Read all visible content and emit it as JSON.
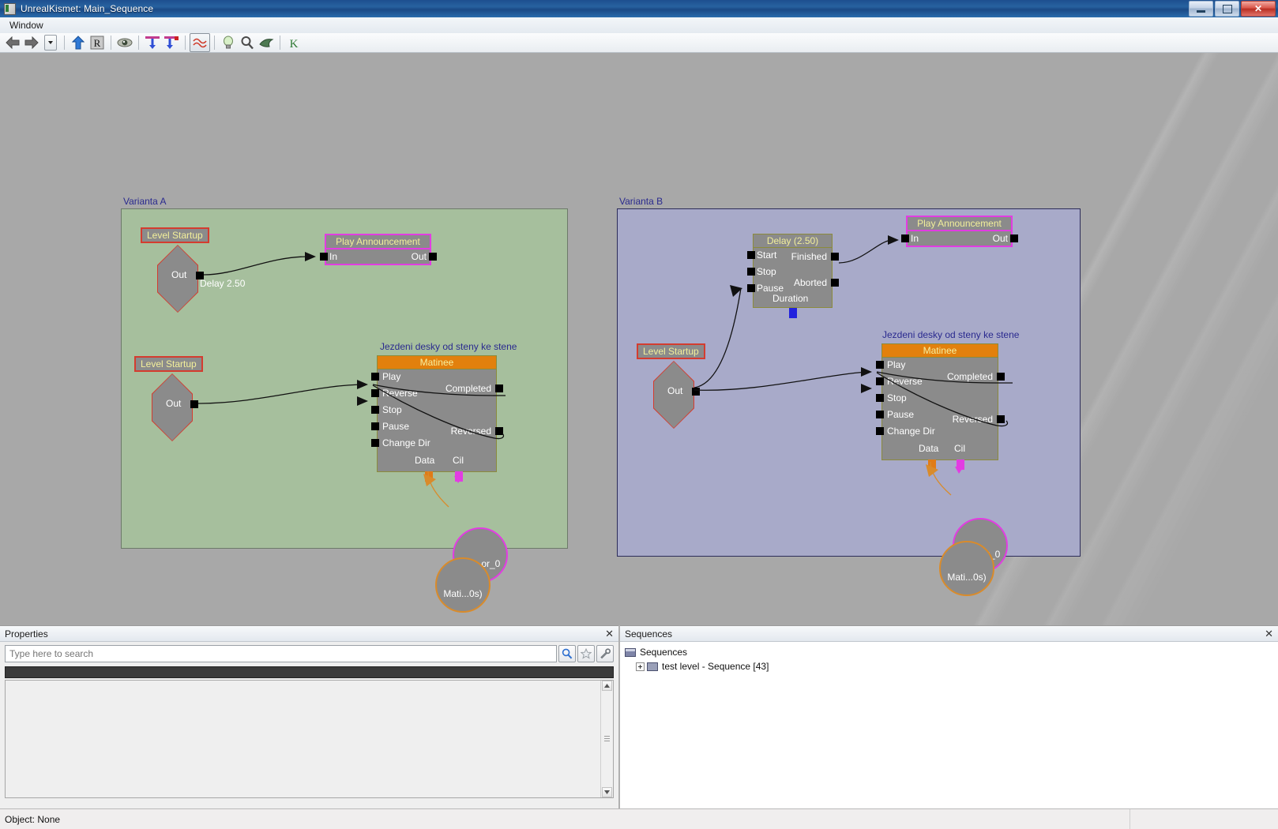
{
  "window": {
    "title": "UnrealKismet: Main_Sequence",
    "icon": "kismet-app-icon",
    "buttons": {
      "minimize": "minimize-icon",
      "maximize": "maximize-icon",
      "close": "✕"
    }
  },
  "menubar": {
    "items": [
      {
        "label": "Window"
      }
    ]
  },
  "toolbar": {
    "items": [
      {
        "name": "back-button",
        "icon": "left-arrow-icon",
        "glyph": "⬅"
      },
      {
        "name": "forward-button",
        "icon": "right-arrow-icon",
        "glyph": "➡"
      },
      {
        "name": "history-dropdown-button",
        "icon": "chevron-down-icon",
        "glyph": "▾"
      },
      {
        "name": "parent-sequence-button",
        "icon": "up-arrow-icon",
        "glyph": "⬆"
      },
      {
        "name": "rename-sequence-button",
        "icon": "letter-r-icon",
        "glyph": "R"
      },
      {
        "name": "hide-connectors-button",
        "icon": "eye-icon",
        "glyph": "◉"
      },
      {
        "name": "show-all-connectors-button",
        "icon": "connector-t-icon",
        "glyph": "T"
      },
      {
        "name": "show-used-connectors-button",
        "icon": "connector-t-red-icon",
        "glyph": "T"
      },
      {
        "name": "curved-connections-toggle",
        "icon": "wave-icon",
        "glyph": "∿",
        "active": true
      },
      {
        "name": "search-actors-button",
        "icon": "lightbulb-icon",
        "glyph": "💡"
      },
      {
        "name": "zoom-to-fit-button",
        "icon": "magnifier-icon",
        "glyph": "🔍"
      },
      {
        "name": "clear-breakpoints-button",
        "icon": "green-shape-icon",
        "glyph": "◣"
      },
      {
        "name": "kismet-debugger-button",
        "icon": "letter-k-icon",
        "glyph": "K"
      }
    ]
  },
  "canvas": {
    "groups": [
      {
        "id": "varianta-a",
        "title": "Varianta A",
        "color": "#a6bf9d",
        "border": "#6d7a6a"
      },
      {
        "id": "varianta-b",
        "title": "Varianta B",
        "color": "#a8aac9",
        "border": "#2c2c5a"
      }
    ],
    "captions": [
      {
        "id": "caption-a",
        "text": "Jezdeni desky od steny ke stene"
      },
      {
        "id": "caption-b",
        "text": "Jezdeni desky od steny ke stene"
      }
    ],
    "nodes": {
      "a_event1": {
        "title": "Level Startup",
        "out": "Out"
      },
      "a_event2": {
        "title": "Level Startup",
        "out": "Out"
      },
      "a_play_announcement": {
        "title": "Play Announcement",
        "in": "In",
        "out": "Out"
      },
      "a_matinee": {
        "title": "Matinee",
        "inputs": [
          "Play",
          "Reverse",
          "Stop",
          "Pause",
          "Change Dir"
        ],
        "outputs": [
          "Completed",
          "Reversed"
        ],
        "variables": [
          "Data",
          "Cil"
        ]
      },
      "b_event1": {
        "title": "Level Startup",
        "out": "Out"
      },
      "b_delay": {
        "title": "Delay (2.50)",
        "inputs": [
          "Start",
          "Stop",
          "Pause"
        ],
        "outputs": [
          "Finished",
          "Aborted"
        ],
        "variables": [
          "Duration"
        ]
      },
      "b_play_announcement": {
        "title": "Play Announcement",
        "in": "In",
        "out": "Out"
      },
      "b_matinee": {
        "title": "Matinee",
        "inputs": [
          "Play",
          "Reverse",
          "Stop",
          "Pause",
          "Change Dir"
        ],
        "outputs": [
          "Completed",
          "Reversed"
        ],
        "variables": [
          "Data",
          "Cil"
        ]
      }
    },
    "variable_nodes": [
      {
        "id": "a-var-interp",
        "label": "Inte..or_0",
        "color": "#e23ce2"
      },
      {
        "id": "a-var-matinee",
        "label": "Mati...0s)",
        "color": "#d98b2b"
      },
      {
        "id": "b-var-interp",
        "label": "Inte..or_0",
        "color": "#e23ce2"
      },
      {
        "id": "b-var-matinee",
        "label": "Mati...0s)",
        "color": "#d98b2b"
      }
    ],
    "edge_labels": [
      {
        "id": "delay-label",
        "text": "Delay 2.50"
      }
    ]
  },
  "properties_panel": {
    "title": "Properties",
    "close_label": "✕",
    "search": {
      "placeholder": "Type here to search",
      "value": ""
    },
    "buttons": [
      {
        "name": "search-button",
        "icon": "magnifier-icon"
      },
      {
        "name": "favorites-button",
        "icon": "star-icon"
      },
      {
        "name": "settings-button",
        "icon": "wrench-icon"
      }
    ]
  },
  "sequences_panel": {
    "title": "Sequences",
    "close_label": "✕",
    "tree": [
      {
        "label": "Sequences",
        "icon": "folder-icon",
        "level": 0,
        "expander": false
      },
      {
        "label": "test level - Sequence [43]",
        "icon": "sequence-icon",
        "level": 1,
        "expander": true
      }
    ]
  },
  "statusbar": {
    "text": "Object: None"
  }
}
